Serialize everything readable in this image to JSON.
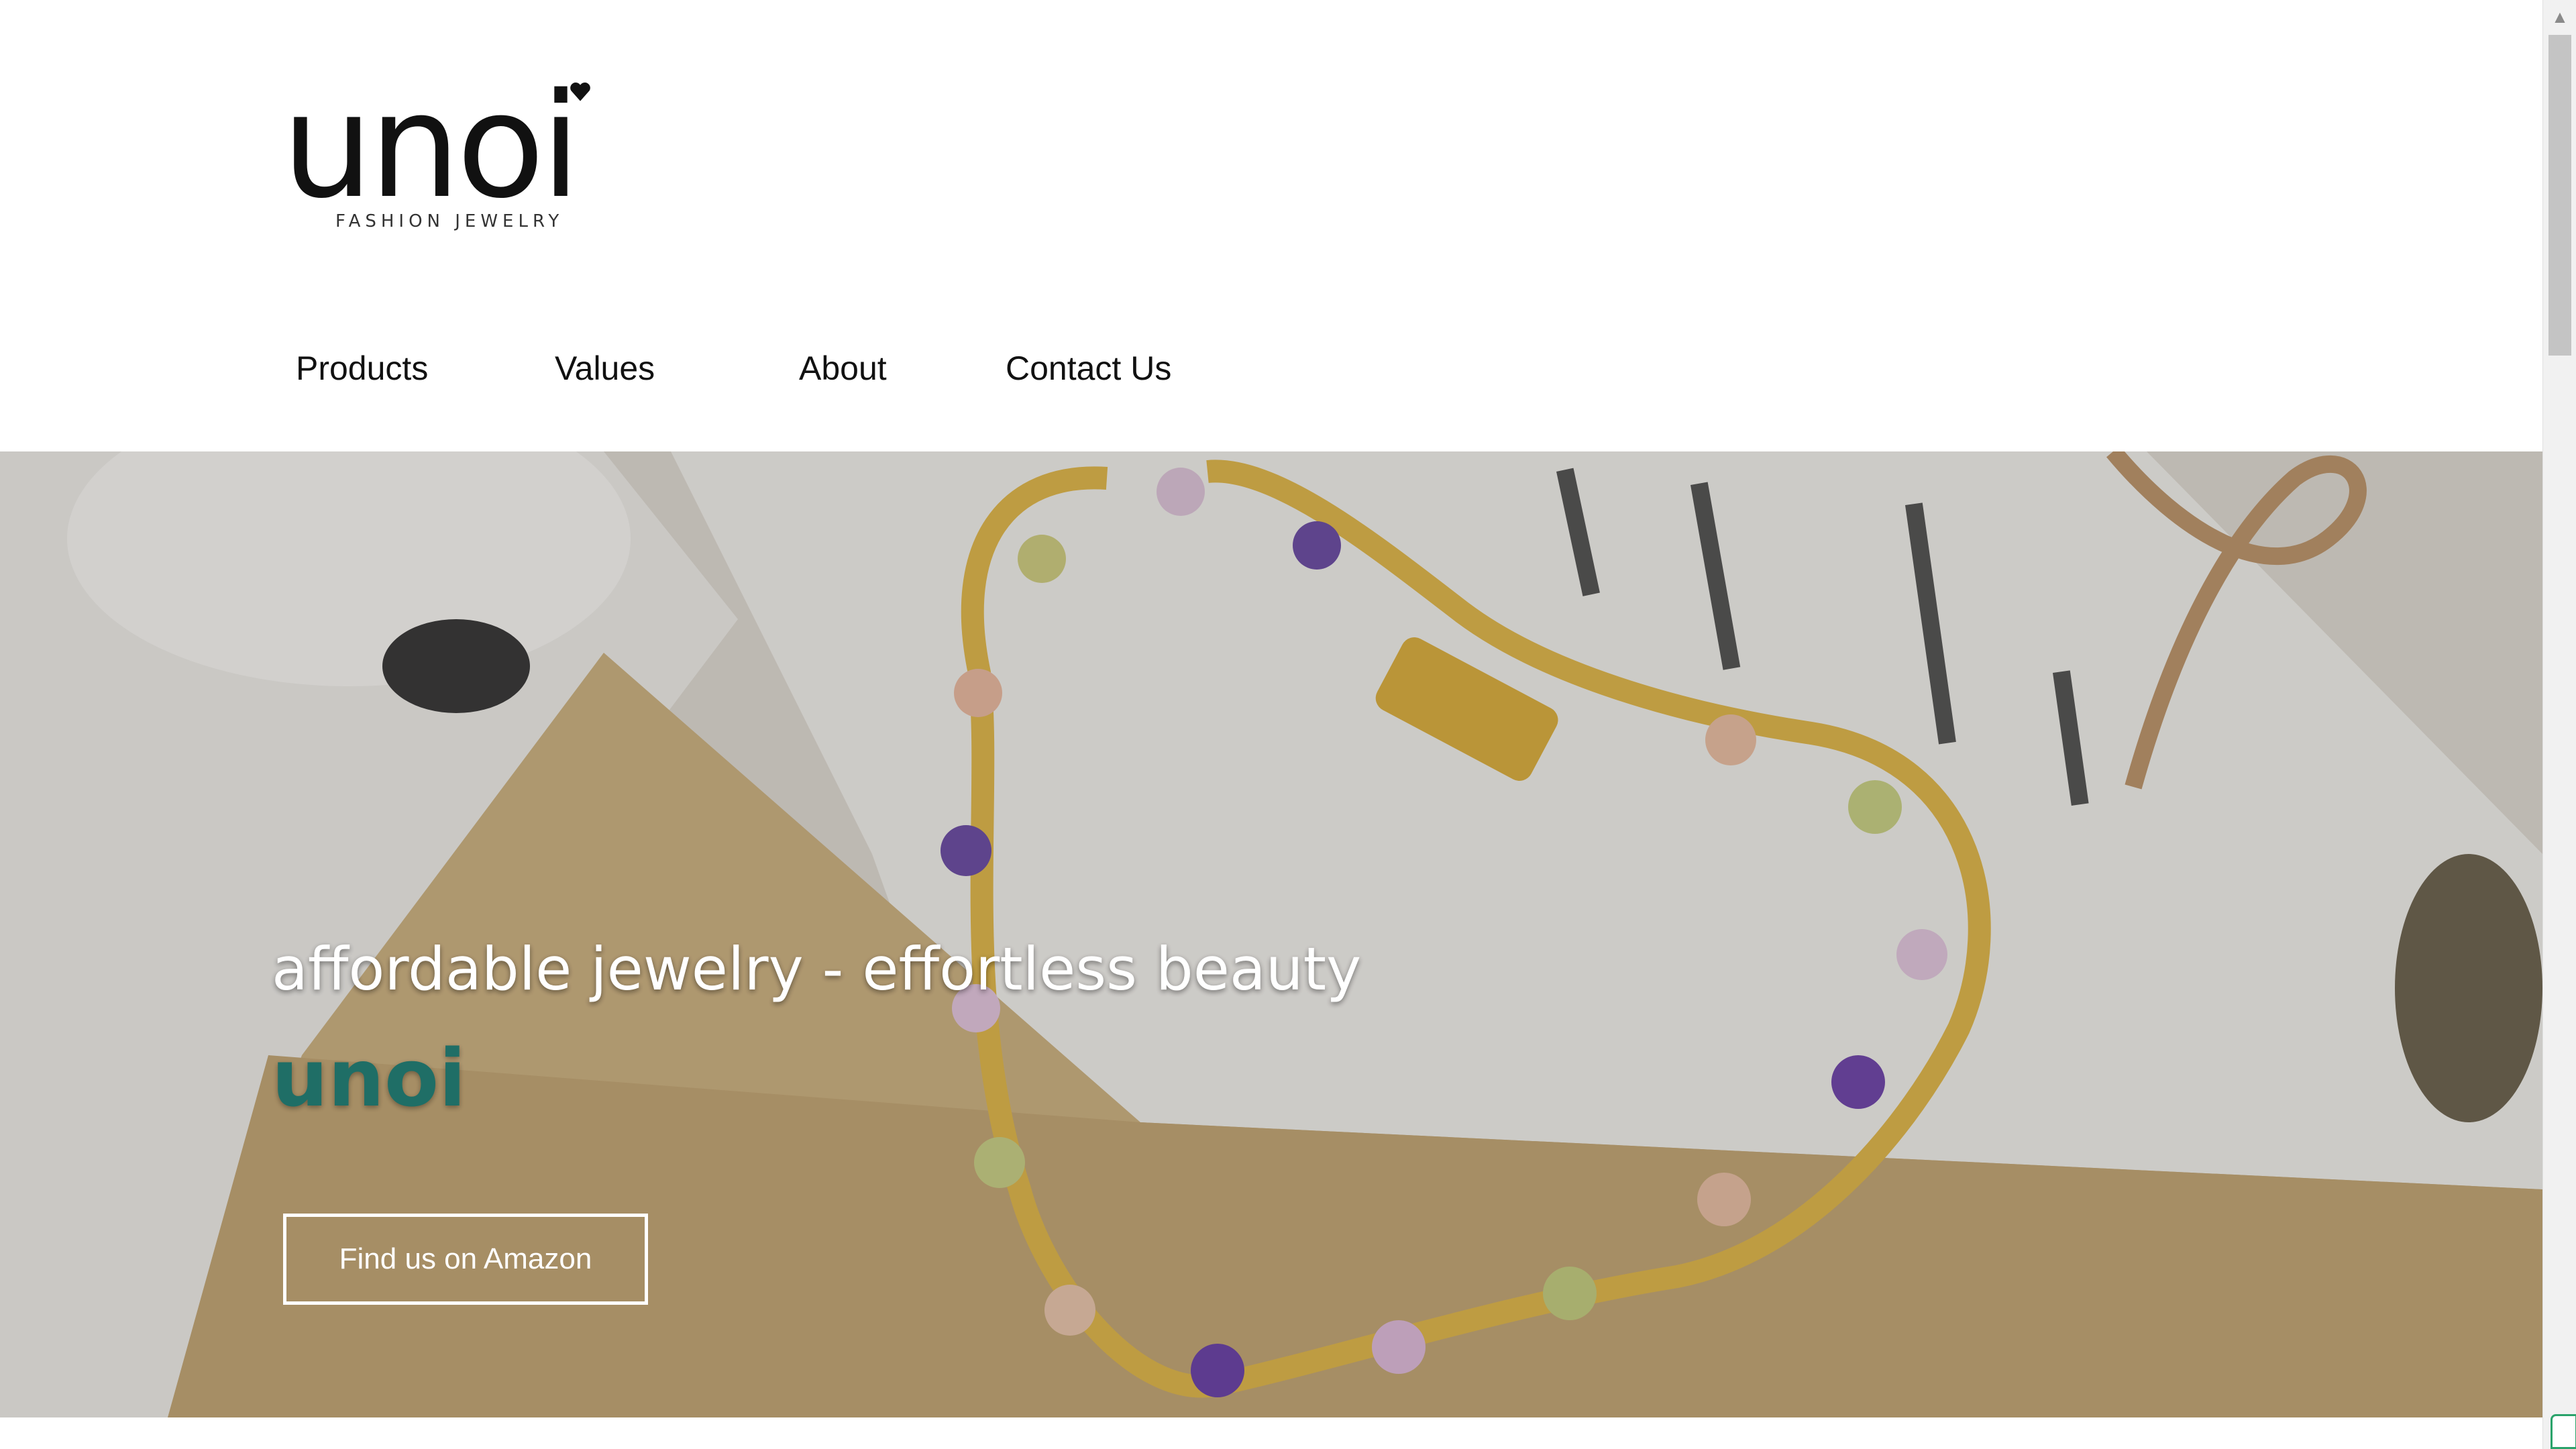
{
  "logo": {
    "word": "unoi",
    "subtitle": "FASHION JEWELRY"
  },
  "nav": {
    "items": [
      {
        "label": "Products"
      },
      {
        "label": "Values"
      },
      {
        "label": "About"
      },
      {
        "label": "Contact Us"
      }
    ]
  },
  "hero": {
    "tagline": "affordable jewelry - effortless beauty",
    "brand": "unoi",
    "cta_label": "Find us on Amazon",
    "brand_color": "#1f6e66"
  },
  "scrollbar": {
    "up_icon": "chevron-up-icon"
  }
}
